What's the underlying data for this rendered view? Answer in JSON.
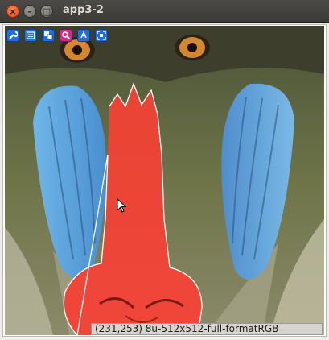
{
  "window": {
    "title": "app3-2",
    "controls": [
      "close",
      "minimize",
      "maximize"
    ],
    "close_glyph": "×",
    "minimize_glyph": "–",
    "maximize_glyph": "□"
  },
  "toolbar": {
    "buttons": [
      {
        "icon": "wrench-icon"
      },
      {
        "icon": "list-icon"
      },
      {
        "icon": "copy-icon"
      },
      {
        "icon": "zoom-icon",
        "active": true
      },
      {
        "icon": "text-icon"
      },
      {
        "icon": "fit-icon"
      }
    ],
    "colors": {
      "button": "#1e6fe0",
      "active": "#d42a8a"
    }
  },
  "viewer": {
    "image_subject": "mandrill",
    "overlay_contour_color": "#ffffff"
  },
  "status": {
    "text": "(231,253) 8u-512x512-full-formatRGB"
  }
}
